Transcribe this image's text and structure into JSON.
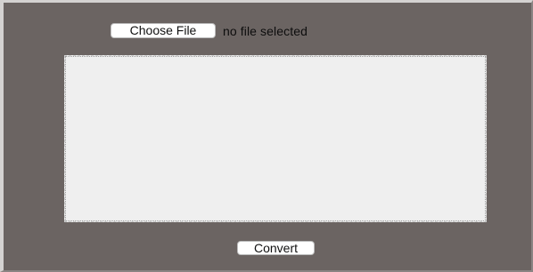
{
  "file_input": {
    "button_label": "Choose File",
    "status_text": "no file selected"
  },
  "convert": {
    "button_label": "Convert"
  }
}
